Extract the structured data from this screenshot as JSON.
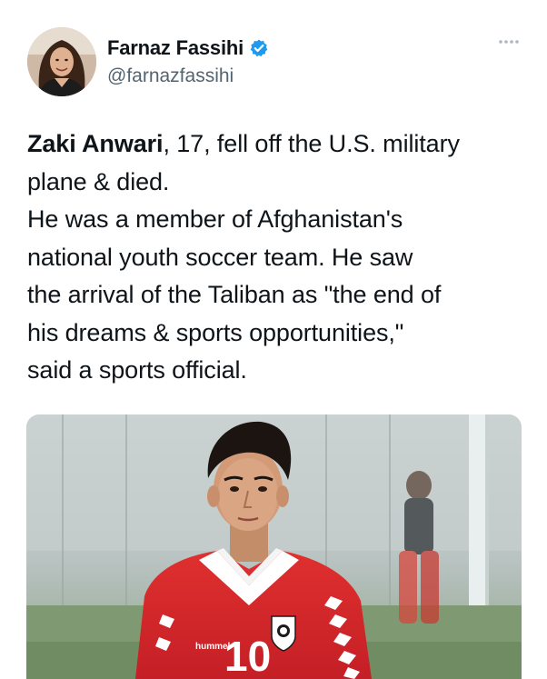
{
  "author": {
    "name": "Farnaz Fassihi",
    "handle": "@farnazfassihi",
    "verified": true,
    "avatar_icon": "avatar-photo"
  },
  "menu": {
    "more_icon": "more-horizontal-icon"
  },
  "tweet": {
    "lines": [
      {
        "bold": "Zaki Anwari",
        "rest": ", 17, fell off the U.S. military"
      },
      {
        "text": "plane & died."
      },
      {
        "text": "He was a member of Afghanistan's"
      },
      {
        "text": "national youth soccer team.  He saw"
      },
      {
        "text": "the arrival of the Taliban as \"the end of"
      },
      {
        "text": "his dreams & sports opportunities,\""
      },
      {
        "text": "said a sports official."
      }
    ]
  },
  "media": {
    "jersey_number": "10",
    "jersey_brand": "hummel"
  },
  "colors": {
    "text": "#0f1419",
    "secondary_text": "#536471",
    "verified_blue": "#1d9bf0",
    "jersey_red": "#d7262b"
  }
}
